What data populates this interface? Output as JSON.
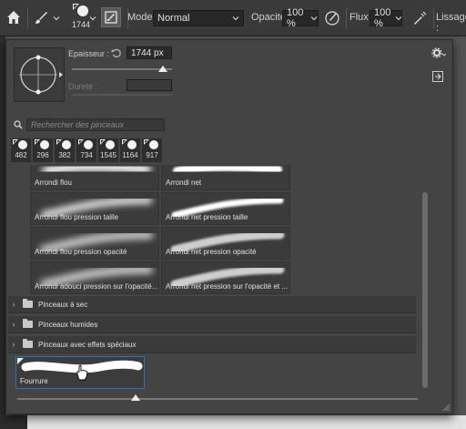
{
  "options_bar": {
    "brush_size": "1744",
    "mode_label": "Mode :",
    "mode_value": "Normal",
    "opacity_label": "Opacité :",
    "opacity_value": "100 %",
    "flow_label": "Flux :",
    "flow_value": "100 %",
    "smoothing_label": "Lissage :"
  },
  "panel": {
    "thickness_label": "Epaisseur :",
    "thickness_value": "1744 px",
    "hardness_label": "Dureté :",
    "search_placeholder": "Rechercher des pinceaux",
    "recent_brushes": [
      "482",
      "296",
      "382",
      "734",
      "1545",
      "1164",
      "917"
    ],
    "brushes": [
      {
        "name": "Arrondi flou"
      },
      {
        "name": "Arrondi net"
      },
      {
        "name": "Arrondi flou pression taille"
      },
      {
        "name": "Arrondi net pression taille"
      },
      {
        "name": "Arrondi flou pression opacité"
      },
      {
        "name": "Arrondi net pression opacité"
      },
      {
        "name": "Arrondi adouci pression sur l'opacité..."
      },
      {
        "name": "Arrondi net pression sur l'opacité et ..."
      }
    ],
    "folders": [
      {
        "name": "Pinceaux à sec"
      },
      {
        "name": "Pinceaux humides"
      },
      {
        "name": "Pinceaux avec effets spéciaux"
      }
    ],
    "selected_brush": "Fourrure"
  },
  "colors": {
    "panel_bg": "#444444",
    "selection": "#2f6fb7"
  }
}
